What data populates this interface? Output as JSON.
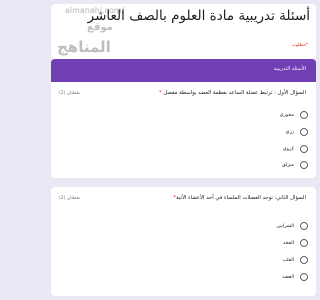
{
  "form": {
    "title": "أسئلة تدريبية مادة العلوم بالصف العاشر",
    "required_note": "*مطلوب"
  },
  "watermark": {
    "url": "almanahj.com/",
    "line1": "موقع",
    "line2": "المناهج"
  },
  "section": {
    "title": "الأسئلة التدريبية"
  },
  "questions": [
    {
      "text": "السؤال الأول : ترتبط عضلة الساعد بعظمة العضد بواسطة مفصل ",
      "required_mark": "*",
      "points": "نقطتان (2)",
      "options": [
        "محوري",
        "رزي",
        "كروي",
        "منزلق"
      ]
    },
    {
      "text": "السؤال الثاني: توجد العضلات الملساء في أحد الأعضاء الآتية",
      "required_mark": "*",
      "points": "نقطتان (2)",
      "options": [
        "الشرايين",
        "الفخذ",
        "القلب",
        "العضد"
      ]
    }
  ],
  "colors": {
    "accent": "#6f3fb3",
    "background": "#ece7f5",
    "required": "#d93025"
  }
}
